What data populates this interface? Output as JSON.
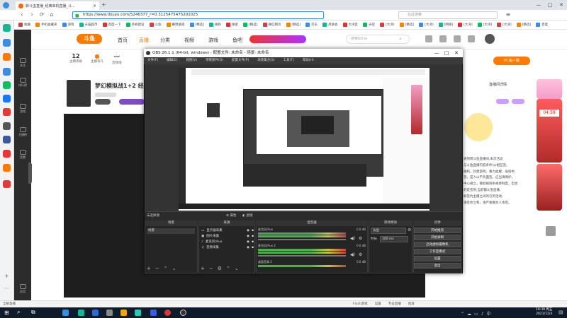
{
  "browser": {
    "tab_title": "转斗虫直播_经典单机直播_斗...",
    "url": "https://www.douyu.com/5246377_r=0.3125475475201025",
    "search_placeholder": "在此搜索",
    "bookmarks": [
      "收藏",
      "手机收藏夹",
      "游戏",
      "天猫超市",
      "百度一下",
      "齐帆建设",
      "斗鱼",
      "赛博朋克",
      "[精选]",
      "搜狗",
      "搜索",
      "[精选]",
      "微信网页",
      "[精选]",
      "京东",
      "月薪会",
      "大湾区",
      "天空",
      "[大湾]",
      "[精选]",
      "[大湾]",
      "[网络]",
      "[大湾]",
      "[大湾]",
      "[大湾]",
      "[精选]",
      "百度"
    ]
  },
  "site": {
    "logo": "斗鱼",
    "nav": [
      "首页",
      "直播",
      "分类",
      "视频",
      "游戏",
      "鱼吧"
    ],
    "search_placeholder": "搜索bilive",
    "left_nav": [
      "关注",
      "排行榜",
      "游戏",
      "主播榜",
      "竞猜",
      "应用"
    ],
    "stats": [
      {
        "value": "12",
        "label": "主播等级"
      },
      {
        "value": "",
        "label": "主播有礼"
      },
      {
        "value": "",
        "label": "音频线"
      }
    ],
    "room_title": "梦幻模拟战1+2 经典",
    "pc_client": "PC客户端",
    "chat_header": "直播间详情",
    "chat_text": [
      "央到转斗鱼直播间,本次活动",
      "与斗鱼直播内容条件(x)相互签。",
      "随机，封建游戏、暴力血腥、低俗色",
      "签，是人以不负面签，应当请保护，",
      "中心规之，敬如规则条规章制度，但也",
      "的是签到,当前都斗虫直播,",
      "如签约主播之间的引到活动,",
      "请签你之和，请严速做为人本签。"
    ],
    "footer_left": "全部直播",
    "footer_right": [
      "Flash游戏",
      "设置",
      "专业直播",
      "回放"
    ]
  },
  "obs": {
    "title": "OBS 26.1.1 (64-bit, windows) - 配置文件: 未命名 - 场景: 未命名",
    "menu": [
      "文件(F)",
      "编辑(E)",
      "视图(V)",
      "停靠部件(D)",
      "配置文件(P)",
      "场景集合(S)",
      "工具(T)",
      "帮助(H)"
    ],
    "transition_label": "未选择源",
    "transition_btns": [
      "属性",
      "滤镜"
    ],
    "docks": {
      "scenes": {
        "title": "场景",
        "items": [
          "场景"
        ]
      },
      "sources": {
        "title": "来源",
        "items": [
          "显示器采集",
          "图片采集",
          "麦克风/Aux",
          "音频采集"
        ]
      },
      "mixer": {
        "title": "混音器",
        "channels": [
          {
            "name": "麦克风/Aux",
            "db": "0.0 dB"
          },
          {
            "name": "麦克风/Aux 2",
            "db": "0.0 dB"
          },
          {
            "name": "桌面音频 2",
            "db": "0.0 dB"
          }
        ]
      },
      "transitions": {
        "title": "转场特效",
        "type": "淡出",
        "duration_label": "时长",
        "duration": "300 ms"
      },
      "controls": {
        "title": "控件",
        "buttons": [
          "开始推流",
          "开始录制",
          "启动虚拟摄像机",
          "工作室模式",
          "设置",
          "退出"
        ]
      }
    }
  },
  "taskbar": {
    "time": "19:39 周五",
    "date": "2021/12/3"
  }
}
